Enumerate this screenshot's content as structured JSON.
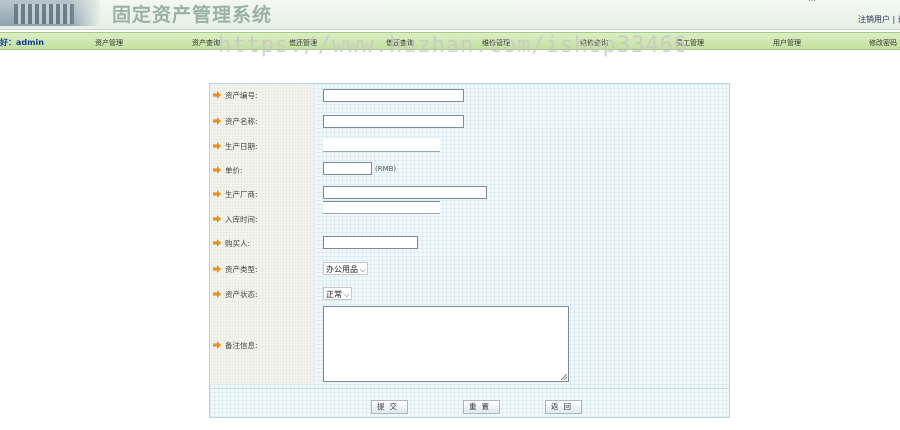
{
  "header": {
    "app_title": "固定资产管理系统",
    "top_right_cut": "...",
    "logout_link": "注销用户 | 退"
  },
  "nav": {
    "greeting": "好：admin",
    "items": [
      "资产管理",
      "资产查询",
      "借还管理",
      "借还查询",
      "维修管理",
      "维修查询",
      "员工管理",
      "用户管理",
      "修改密码"
    ]
  },
  "watermark": "https://www.huzhan.com/ishop33466",
  "form": {
    "fields": {
      "asset_no": {
        "label": "资产编号:",
        "value": ""
      },
      "asset_name": {
        "label": "资产名称:",
        "value": ""
      },
      "production_date": {
        "label": "生产日期:",
        "value": ""
      },
      "unit_price": {
        "label": "单价:",
        "value": "",
        "unit": "(RMB)"
      },
      "manufacturer": {
        "label": "生产厂商:",
        "value": ""
      },
      "storage_time": {
        "label": "入库时间:",
        "value": ""
      },
      "buyer": {
        "label": "购买人:",
        "value": ""
      },
      "asset_type": {
        "label": "资产类型:",
        "selected": "办公用品"
      },
      "asset_status": {
        "label": "资产状态:",
        "selected": "正常"
      },
      "remarks": {
        "label": "备注信息:",
        "value": ""
      }
    },
    "buttons": {
      "submit": "提交",
      "reset": "重置",
      "back": "返回"
    }
  },
  "colors": {
    "nav_bg": "#c4e09f",
    "greeting": "#0a3aa8",
    "arrow": "#e8941a",
    "title": "#9ab1a7"
  }
}
